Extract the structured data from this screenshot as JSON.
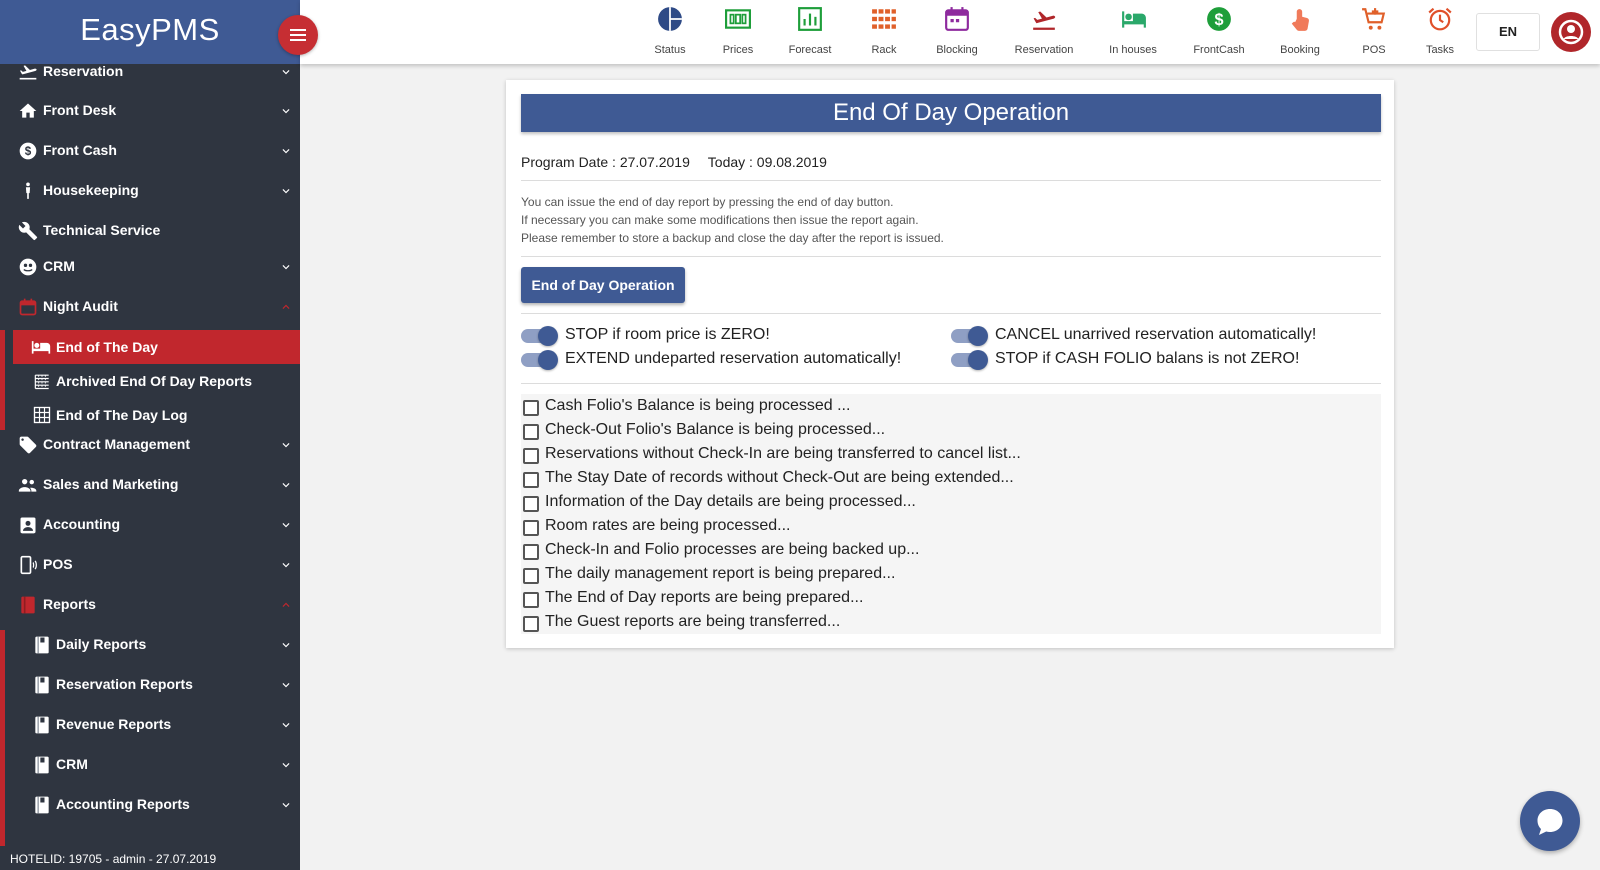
{
  "brand": {
    "name": "EasyPMS"
  },
  "sidebar": {
    "items": [
      {
        "label": "Reservation",
        "icon": "plane-departure-icon"
      },
      {
        "label": "Front Desk",
        "icon": "home-icon"
      },
      {
        "label": "Front Cash",
        "icon": "dollar-circle-icon"
      },
      {
        "label": "Housekeeping",
        "icon": "person-icon"
      },
      {
        "label": "Technical Service",
        "icon": "wrench-icon"
      },
      {
        "label": "CRM",
        "icon": "globe-icon"
      },
      {
        "label": "Night Audit",
        "icon": "calendar-icon"
      },
      {
        "label": "End of The Day",
        "icon": "bed-icon"
      },
      {
        "label": "Archived End Of Day Reports",
        "icon": "list-icon"
      },
      {
        "label": "End of The Day Log",
        "icon": "grid-icon"
      },
      {
        "label": "Contract Management",
        "icon": "tag-icon"
      },
      {
        "label": "Sales and Marketing",
        "icon": "people-icon"
      },
      {
        "label": "Accounting",
        "icon": "contact-icon"
      },
      {
        "label": "POS",
        "icon": "mobile-icon"
      },
      {
        "label": "Reports",
        "icon": "book-icon"
      },
      {
        "label": "Daily Reports",
        "icon": "book-icon"
      },
      {
        "label": "Reservation Reports",
        "icon": "book-icon"
      },
      {
        "label": "Revenue Reports",
        "icon": "book-icon"
      },
      {
        "label": "CRM",
        "icon": "book-icon"
      },
      {
        "label": "Accounting Reports",
        "icon": "book-icon"
      }
    ],
    "footer": "HOTELID: 19705 - admin - 27.07.2019"
  },
  "toolbar": {
    "items": [
      {
        "label": "Status",
        "icon": "pie-chart-icon",
        "color": "#2e4a86"
      },
      {
        "label": "Prices",
        "icon": "money-icon",
        "color": "#1e9e3a"
      },
      {
        "label": "Forecast",
        "icon": "bar-chart-icon",
        "color": "#1e9e3a"
      },
      {
        "label": "Rack",
        "icon": "grid-icon",
        "color": "#e0602a"
      },
      {
        "label": "Blocking",
        "icon": "calendar-icon",
        "color": "#8e2a9e"
      },
      {
        "label": "Reservation",
        "icon": "plane-departure-icon",
        "color": "#b0262a"
      },
      {
        "label": "In houses",
        "icon": "bed-icon",
        "color": "#2aa86a"
      },
      {
        "label": "FrontCash",
        "icon": "dollar-circle-icon",
        "color": "#1e9e3a"
      },
      {
        "label": "Booking",
        "icon": "touch-icon",
        "color": "#f07a5a"
      },
      {
        "label": "POS",
        "icon": "cart-icon",
        "color": "#e0602a"
      },
      {
        "label": "Tasks",
        "icon": "alarm-icon",
        "color": "#e0502a"
      }
    ],
    "language": "EN"
  },
  "main": {
    "title": "End Of Day Operation",
    "program_date": "Program Date : 27.07.2019",
    "today": "Today : 09.08.2019",
    "info_lines": [
      "You can issue the end of day report by pressing the end of day button.",
      "If necessary you can make some modifications then issue the report again.",
      "Please remember to store a backup and close the day after the report is issued."
    ],
    "button_label": "End of Day Operation",
    "toggles": [
      {
        "label": "STOP if room price is ZERO!",
        "on": true
      },
      {
        "label": "CANCEL unarrived reservation automatically!",
        "on": true
      },
      {
        "label": "EXTEND undeparted reservation automatically!",
        "on": true
      },
      {
        "label": "STOP if CASH FOLIO balans is not ZERO!",
        "on": true
      }
    ],
    "checklist": [
      "Cash Folio's Balance is being processed ...",
      "Check-Out Folio's Balance is being processed...",
      "Reservations without Check-In are being transferred to cancel list...",
      "The Stay Date of records without Check-Out are being extended...",
      "Information of the Day details are being processed...",
      "Room rates are being processed...",
      "Check-In and Folio processes are being backed up...",
      "The daily management report is being prepared...",
      "The End of Day reports are being prepared...",
      "The Guest reports are being transferred..."
    ]
  },
  "colors": {
    "brand_blue": "#3f5a94",
    "accent_red": "#c1272d",
    "sidebar_bg": "#2f3540"
  }
}
